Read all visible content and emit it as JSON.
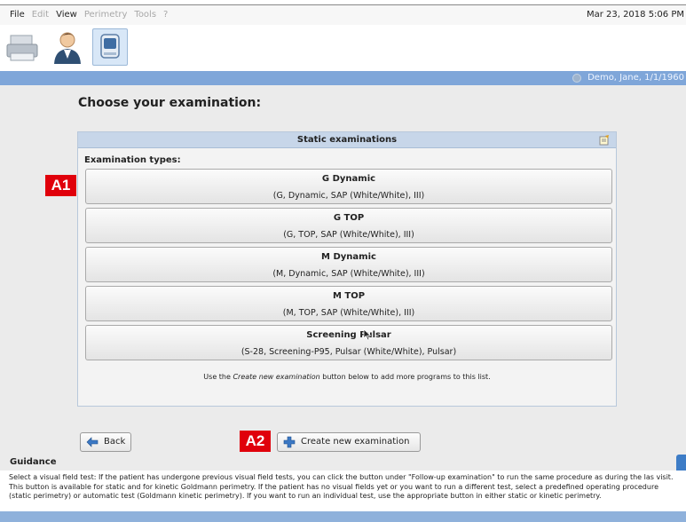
{
  "menu": {
    "items": [
      {
        "label": "File",
        "enabled": true
      },
      {
        "label": "Edit",
        "enabled": false
      },
      {
        "label": "View",
        "enabled": true
      },
      {
        "label": "Perimetry",
        "enabled": false
      },
      {
        "label": "Tools",
        "enabled": false
      },
      {
        "label": "?",
        "enabled": false
      }
    ],
    "datetime": "Mar 23, 2018 5:06 PM"
  },
  "toolbar": {
    "icons": [
      "printer-icon",
      "patient-icon",
      "perimeter-device-icon"
    ],
    "selected": "perimeter-device-icon"
  },
  "patient_bar": {
    "user": "Demo, Jane, 1/1/1960"
  },
  "main": {
    "heading": "Choose your examination:",
    "panel": {
      "title": "Static examinations",
      "types_label": "Examination types:",
      "exams": [
        {
          "title": "G Dynamic",
          "subtitle": "(G, Dynamic, SAP (White/White), III)"
        },
        {
          "title": "G TOP",
          "subtitle": "(G, TOP, SAP (White/White), III)"
        },
        {
          "title": "M Dynamic",
          "subtitle": "(M, Dynamic, SAP (White/White), III)"
        },
        {
          "title": "M TOP",
          "subtitle": "(M, TOP, SAP (White/White), III)"
        },
        {
          "title": "Screening Pulsar",
          "subtitle": "(S-28, Screening-P95, Pulsar (White/White), Pulsar)"
        }
      ],
      "hint_pre": "Use the ",
      "hint_em": "Create new examination",
      "hint_post": " button below to add more programs to this list."
    },
    "tags": {
      "a1": "A1",
      "a2": "A2"
    },
    "back_label": "Back",
    "create_label": "Create new examination"
  },
  "guidance": {
    "label": "Guidance",
    "text": "Select a visual field test: If the patient has undergone previous visual field tests, you can click the button under \"Follow-up examination\" to run the same procedure as during the las visit. This button is available for static and for kinetic Goldmann perimetry. If the patient has no visual fields yet or you want to run a different test, select a predefined operating procedure (static perimetry) or automatic test (Goldmann kinetic perimetry). If you want to run an individual test, use the appropriate button in either static or kinetic perimetry."
  },
  "colors": {
    "accent_bar": "#7fa6d9",
    "panel_header": "#c7d6e9",
    "tag_red": "#e0000b",
    "background": "#ebebeb"
  }
}
